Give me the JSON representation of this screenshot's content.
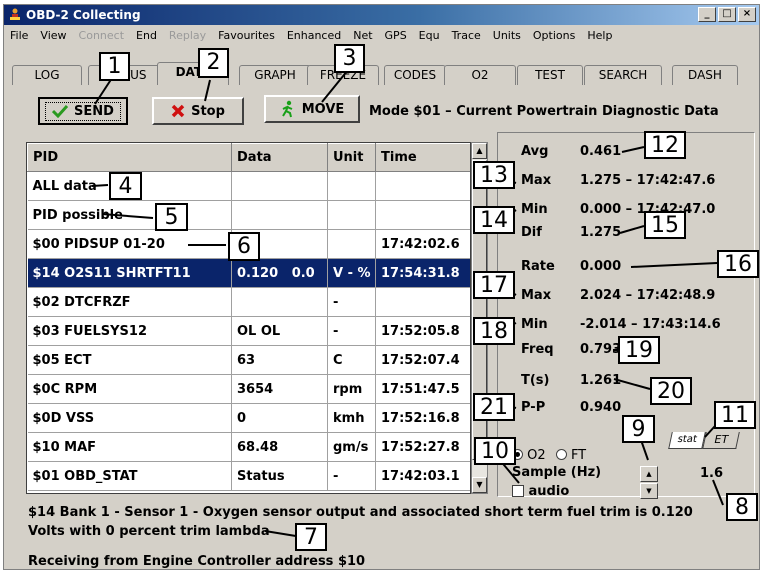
{
  "window": {
    "title": "OBD-2 Collecting"
  },
  "menu": [
    {
      "label": "File",
      "enabled": true
    },
    {
      "label": "View",
      "enabled": true
    },
    {
      "label": "Connect",
      "enabled": false
    },
    {
      "label": "End",
      "enabled": true
    },
    {
      "label": "Replay",
      "enabled": false
    },
    {
      "label": "Favourites",
      "enabled": true
    },
    {
      "label": "Enhanced",
      "enabled": true
    },
    {
      "label": "Net",
      "enabled": true
    },
    {
      "label": "GPS",
      "enabled": true
    },
    {
      "label": "Equ",
      "enabled": true
    },
    {
      "label": "Trace",
      "enabled": true
    },
    {
      "label": "Units",
      "enabled": true
    },
    {
      "label": "Options",
      "enabled": true
    },
    {
      "label": "Help",
      "enabled": true
    }
  ],
  "tabs": [
    {
      "label": "LOG"
    },
    {
      "label": "STATUS"
    },
    {
      "label": "DATA",
      "active": true
    },
    {
      "label": "GRAPH"
    },
    {
      "label": "FREEZE"
    },
    {
      "label": "CODES"
    },
    {
      "label": "O2"
    },
    {
      "label": "TEST"
    },
    {
      "label": "SEARCH"
    },
    {
      "label": "DASH"
    }
  ],
  "toolbar": {
    "send_label": "SEND",
    "stop_label": "Stop",
    "move_label": "MOVE"
  },
  "mode_text": "Mode $01 – Current Powertrain Diagnostic Data",
  "grid": {
    "columns": [
      "PID",
      "Data",
      "Unit",
      "Time"
    ],
    "rows": [
      {
        "pid": "ALL data",
        "data": "",
        "unit": "",
        "time": ""
      },
      {
        "pid": "PID possible",
        "data": "",
        "unit": "",
        "time": ""
      },
      {
        "pid": "$00  PIDSUP 01-20",
        "data": "P",
        "unit": "",
        "time": "17:42:02.6"
      },
      {
        "pid": "$14  O2S11 SHRTFT11",
        "data": "0.120   0.0",
        "unit": "V - %",
        "time": "17:54:31.8",
        "selected": true
      },
      {
        "pid": "$02  DTCFRZF",
        "data": "",
        "unit": "-",
        "time": ""
      },
      {
        "pid": "$03  FUELSYS12",
        "data": "OL OL",
        "unit": "-",
        "time": "17:52:05.8"
      },
      {
        "pid": "$05  ECT",
        "data": "63",
        "unit": "C",
        "time": "17:52:07.4"
      },
      {
        "pid": "$0C  RPM",
        "data": "3654",
        "unit": "rpm",
        "time": "17:51:47.5"
      },
      {
        "pid": "$0D  VSS",
        "data": "0",
        "unit": "kmh",
        "time": "17:52:16.8"
      },
      {
        "pid": "$10  MAF",
        "data": "68.48",
        "unit": "gm/s",
        "time": "17:52:27.8"
      },
      {
        "pid": "$01  OBD_STAT",
        "data": "Status",
        "unit": "-",
        "time": "17:42:03.1"
      }
    ]
  },
  "stats": {
    "avg_label": "Avg",
    "avg": "0.461",
    "max_label": "Max",
    "max": "1.275 – 17:42:47.6",
    "min_label": "Min",
    "min": "0.000 – 17:42:47.0",
    "dif_label": "Dif",
    "dif": "1.275",
    "rate_label": "Rate",
    "rate": "0.000",
    "rmax_label": "Max",
    "rmax": "2.024 – 17:42:48.9",
    "rmin_label": "Min",
    "rmin": "-2.014 – 17:43:14.6",
    "freq_label": "Freq",
    "freq": "0.793",
    "ts_label": "T(s)",
    "ts": "1.261",
    "pp_label": "P-P",
    "pp": "0.940"
  },
  "controls": {
    "o2_label": "O2",
    "ft_label": "FT",
    "sample_label": "Sample (Hz)",
    "audio_label": "audio",
    "sample_value": "1.6",
    "stat_tab": "stat",
    "et_tab": "ET"
  },
  "status": {
    "line1": "$14  Bank 1 - Sensor 1 - Oxygen sensor output and associated short term fuel trim is 0.120",
    "line2": "Volts with 0 percent trim lambda",
    "line3": "Receiving from Engine Controller address $10"
  },
  "callouts": [
    "1",
    "2",
    "3",
    "4",
    "5",
    "6",
    "7",
    "8",
    "9",
    "10",
    "11",
    "12",
    "13",
    "14",
    "15",
    "16",
    "17",
    "18",
    "19",
    "20",
    "21"
  ],
  "colors": {
    "selection": "#0a246a",
    "title_start": "#0a246a",
    "title_end": "#a6caf0",
    "face": "#d4d0c8"
  }
}
